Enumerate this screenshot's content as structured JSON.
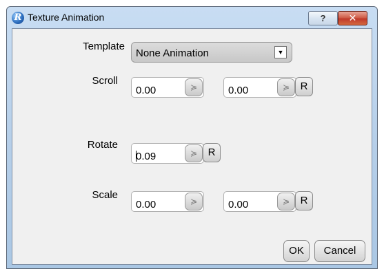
{
  "window": {
    "title": "Texture Animation",
    "app_icon_glyph": "R",
    "help_glyph": "?",
    "close_glyph": "✕"
  },
  "template": {
    "label": "Template",
    "selected": "None Animation",
    "arrow_glyph": "▼"
  },
  "scroll": {
    "label": "Scroll",
    "x_value": "0.00",
    "y_value": "0.00",
    "reset_label": "R"
  },
  "rotate": {
    "label": "Rotate",
    "value": "0.09",
    "reset_label": "R"
  },
  "scale": {
    "label": "Scale",
    "x_value": "0.00",
    "y_value": "0.00",
    "reset_label": "R"
  },
  "spin_glyph": "≽",
  "buttons": {
    "ok": "OK",
    "cancel": "Cancel"
  },
  "icons": [
    "app-logo-icon",
    "help-icon",
    "close-icon",
    "dropdown-arrow-icon",
    "spin-chevron-icon"
  ]
}
